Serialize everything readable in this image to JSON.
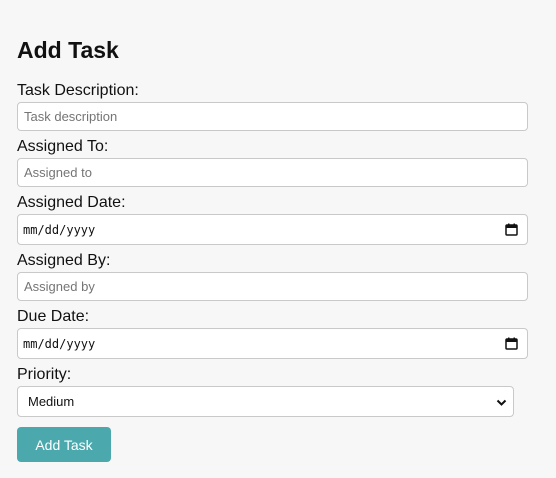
{
  "form": {
    "title": "Add Task",
    "fields": {
      "task_description": {
        "label": "Task Description:",
        "placeholder": "Task description",
        "value": ""
      },
      "assigned_to": {
        "label": "Assigned To:",
        "placeholder": "Assigned to",
        "value": ""
      },
      "assigned_date": {
        "label": "Assigned Date:",
        "display": "mm/dd/yyyy",
        "icon": "calendar-icon"
      },
      "assigned_by": {
        "label": "Assigned By:",
        "placeholder": "Assigned by",
        "value": ""
      },
      "due_date": {
        "label": "Due Date:",
        "display": "mm/dd/yyyy",
        "icon": "calendar-icon"
      },
      "priority": {
        "label": "Priority:",
        "selected": "Medium",
        "icon": "chevron-down-icon"
      }
    },
    "submit_label": "Add Task"
  },
  "colors": {
    "background": "#f7f7f7",
    "button": "#4ba9ae",
    "button_text": "#ffffff",
    "input_border": "#c9c9c9",
    "placeholder_text": "#757575"
  }
}
